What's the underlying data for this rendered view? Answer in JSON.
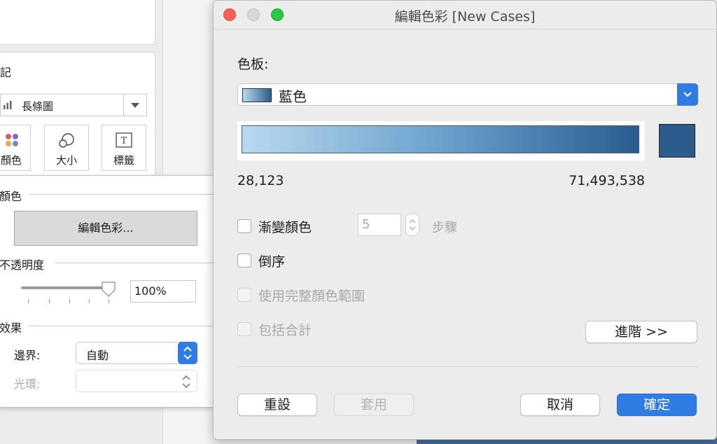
{
  "background": {
    "marks_card": {
      "title": "記",
      "mark_type": "長條圖",
      "buttons": [
        {
          "label": "顏色",
          "icon": "color-dots-icon"
        },
        {
          "label": "大小",
          "icon": "size-circles-icon"
        },
        {
          "label": "標籤",
          "icon": "text-label-icon",
          "glyph": "T"
        }
      ]
    },
    "color_popup": {
      "color_section": "顏色",
      "edit_colors_button": "編輯色彩...",
      "opacity_section": "不透明度",
      "opacity_value": 1.0,
      "opacity_text": "100%",
      "effects_section": "效果",
      "border_label": "邊界:",
      "border_value": "自動",
      "halo_label": "光環:",
      "halo_value": ""
    }
  },
  "dialog": {
    "title": "編輯色彩 [New Cases]",
    "palette_label": "色板:",
    "palette_value": "藍色",
    "ramp_colors": {
      "start": "#b9d9ef",
      "mid": "#6aa2cc",
      "end": "#2a5d8f"
    },
    "end_swatch_color": "#2c5b8c",
    "min_value": "28,123",
    "max_value": "71,493,538",
    "options": {
      "stepped_color": {
        "label": "漸變顏色",
        "checked": false,
        "enabled": true
      },
      "steps_value": "5",
      "steps_label": "步驟",
      "reversed": {
        "label": "倒序",
        "checked": false,
        "enabled": true
      },
      "use_full_range": {
        "label": "使用完整顏色範圍",
        "checked": false,
        "enabled": false
      },
      "include_totals": {
        "label": "包括合計",
        "checked": false,
        "enabled": false
      }
    },
    "advanced_button": "進階 >>",
    "buttons": {
      "reset": "重設",
      "apply": "套用",
      "cancel": "取消",
      "ok": "確定"
    },
    "accent_color": "#2f7de4"
  }
}
